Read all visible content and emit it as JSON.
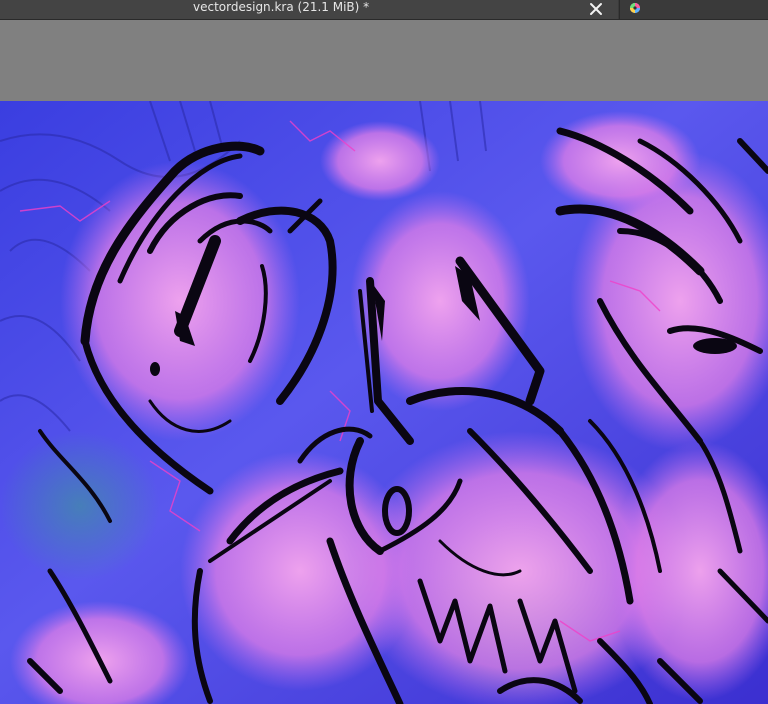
{
  "document_tab": {
    "title": "vectordesign.kra (21.1 MiB) *",
    "close_icon": "close-icon"
  },
  "app_icon": "krita-icon",
  "colors": {
    "tab_bar": "#3a3a3a",
    "active_tab": "#444444",
    "tab_text": "#e6e6e6",
    "canvas_backdrop": "#808080",
    "art_blue": "#4f4fe6",
    "art_pink": "#e680ea",
    "art_ink": "#0a0612"
  }
}
